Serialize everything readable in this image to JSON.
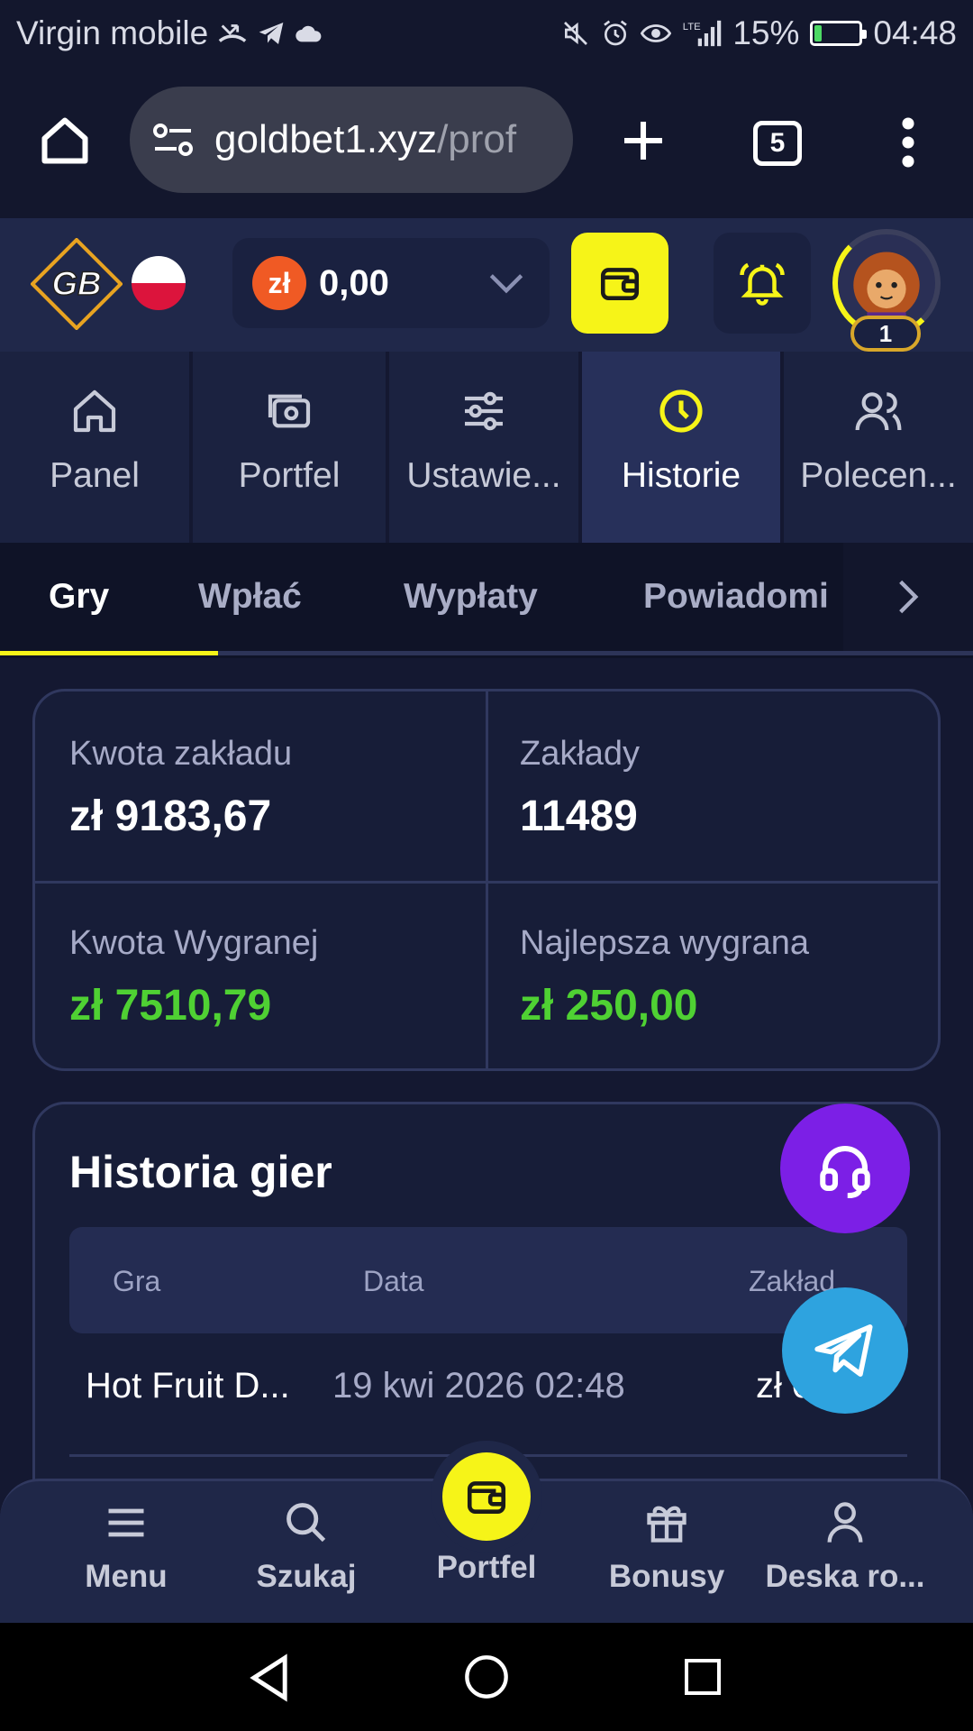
{
  "status_bar": {
    "carrier": "Virgin mobile",
    "battery_percent": "15%",
    "battery_level": 0.15,
    "time": "04:48",
    "network": "LTE"
  },
  "browser": {
    "url_host": "goldbet1.xyz",
    "url_path": "/prof",
    "tab_count": "5"
  },
  "header": {
    "logo_text": "GB",
    "currency_symbol": "zł",
    "balance": "0,00",
    "level": "1",
    "accent_color": "#f6f418"
  },
  "profile_nav": [
    {
      "label": "Panel",
      "icon": "home-icon"
    },
    {
      "label": "Portfel",
      "icon": "wallet-icon"
    },
    {
      "label": "Ustawie...",
      "icon": "settings-sliders-icon"
    },
    {
      "label": "Historie",
      "icon": "clock-icon",
      "active": true
    },
    {
      "label": "Polecen...",
      "icon": "users-icon"
    }
  ],
  "sub_tabs": [
    {
      "label": "Gry",
      "active": true
    },
    {
      "label": "Wpłać"
    },
    {
      "label": "Wypłaty"
    },
    {
      "label": "Powiadomi"
    }
  ],
  "stats": {
    "bet_amount_label": "Kwota zakładu",
    "bet_amount_value": "zł 9183,67",
    "bets_label": "Zakłady",
    "bets_value": "11489",
    "win_amount_label": "Kwota Wygranej",
    "win_amount_value": "zł 7510,79",
    "best_win_label": "Najlepsza wygrana",
    "best_win_value": "zł 250,00"
  },
  "history": {
    "title": "Historia gier",
    "columns": [
      "Gra",
      "Data",
      "Zakład"
    ],
    "rows": [
      {
        "game": "Hot Fruit D...",
        "date": "19 kwi 2026 02:48",
        "bet": "zł 0,0"
      }
    ]
  },
  "bottom_nav": [
    {
      "label": "Menu",
      "icon": "menu-icon"
    },
    {
      "label": "Szukaj",
      "icon": "search-icon"
    },
    {
      "label": "Portfel",
      "icon": "wallet-icon"
    },
    {
      "label": "Bonusy",
      "icon": "gift-icon"
    },
    {
      "label": "Deska ro...",
      "icon": "user-icon"
    }
  ]
}
